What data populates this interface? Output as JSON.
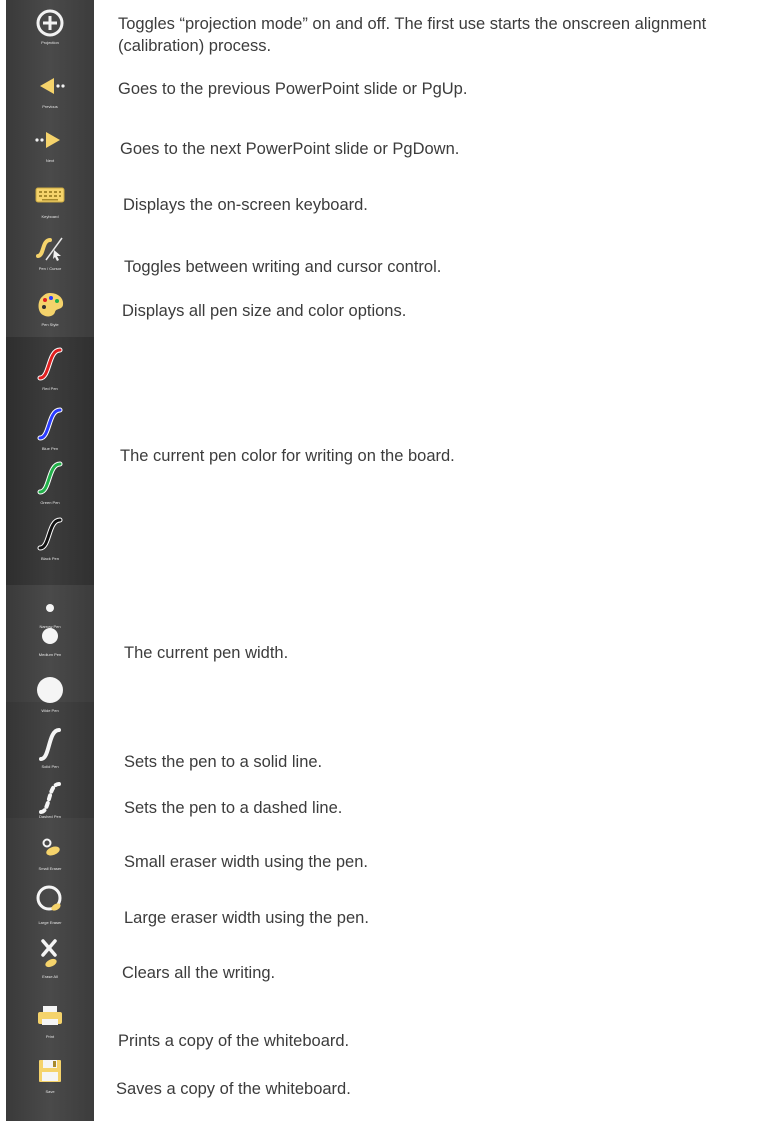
{
  "tools": [
    {
      "name": "projection-icon",
      "label": "Projection"
    },
    {
      "name": "previous-arrow-icon",
      "label": "Previous"
    },
    {
      "name": "next-arrow-icon",
      "label": "Next"
    },
    {
      "name": "keyboard-icon",
      "label": "Keyboard"
    },
    {
      "name": "pen-cursor-icon",
      "label": "Pen / Cursor"
    },
    {
      "name": "palette-icon",
      "label": "Pen Style"
    },
    {
      "name": "red-pen-icon",
      "label": "Red Pen",
      "color": "#e02020"
    },
    {
      "name": "blue-pen-icon",
      "label": "Blue Pen",
      "color": "#2a3cff"
    },
    {
      "name": "green-pen-icon",
      "label": "Green Pen",
      "color": "#22b04a"
    },
    {
      "name": "black-pen-icon",
      "label": "Black Pen",
      "color": "#111111"
    },
    {
      "name": "narrow-pen-icon",
      "label": "Narrow Pen"
    },
    {
      "name": "medium-pen-icon",
      "label": "Medium Pen"
    },
    {
      "name": "wide-pen-icon",
      "label": "Wide Pen"
    },
    {
      "name": "solid-pen-icon",
      "label": "Solid Pen"
    },
    {
      "name": "dashed-pen-icon",
      "label": "Dashed Pen"
    },
    {
      "name": "small-eraser-icon",
      "label": "Small Eraser"
    },
    {
      "name": "large-eraser-icon",
      "label": "Large Eraser"
    },
    {
      "name": "erase-all-icon",
      "label": "Erase All"
    },
    {
      "name": "print-icon",
      "label": "Print"
    },
    {
      "name": "save-icon",
      "label": "Save"
    }
  ],
  "descriptions": {
    "projection": "Toggles “projection mode” on and off. The first use starts the onscreen alignment (calibration) process.",
    "previous": "Goes to the previous PowerPoint slide or PgUp.",
    "next": "Goes to the next PowerPoint slide or PgDown.",
    "keyboard": "Displays the on-screen keyboard.",
    "pen_cursor": "Toggles between writing and cursor control.",
    "pen_style": "Displays all pen size and color options.",
    "pen_color": "The current pen color for writing on the board.",
    "pen_width": "The current pen width.",
    "solid": "Sets the pen to a solid line.",
    "dashed": "Sets the pen to a dashed line.",
    "small_eraser": "Small eraser width using the pen.",
    "large_eraser": "Large eraser width using the pen.",
    "erase_all": "Clears all the writing.",
    "print": "Prints a copy of the whiteboard.",
    "save": "Saves a copy of the whiteboard."
  }
}
